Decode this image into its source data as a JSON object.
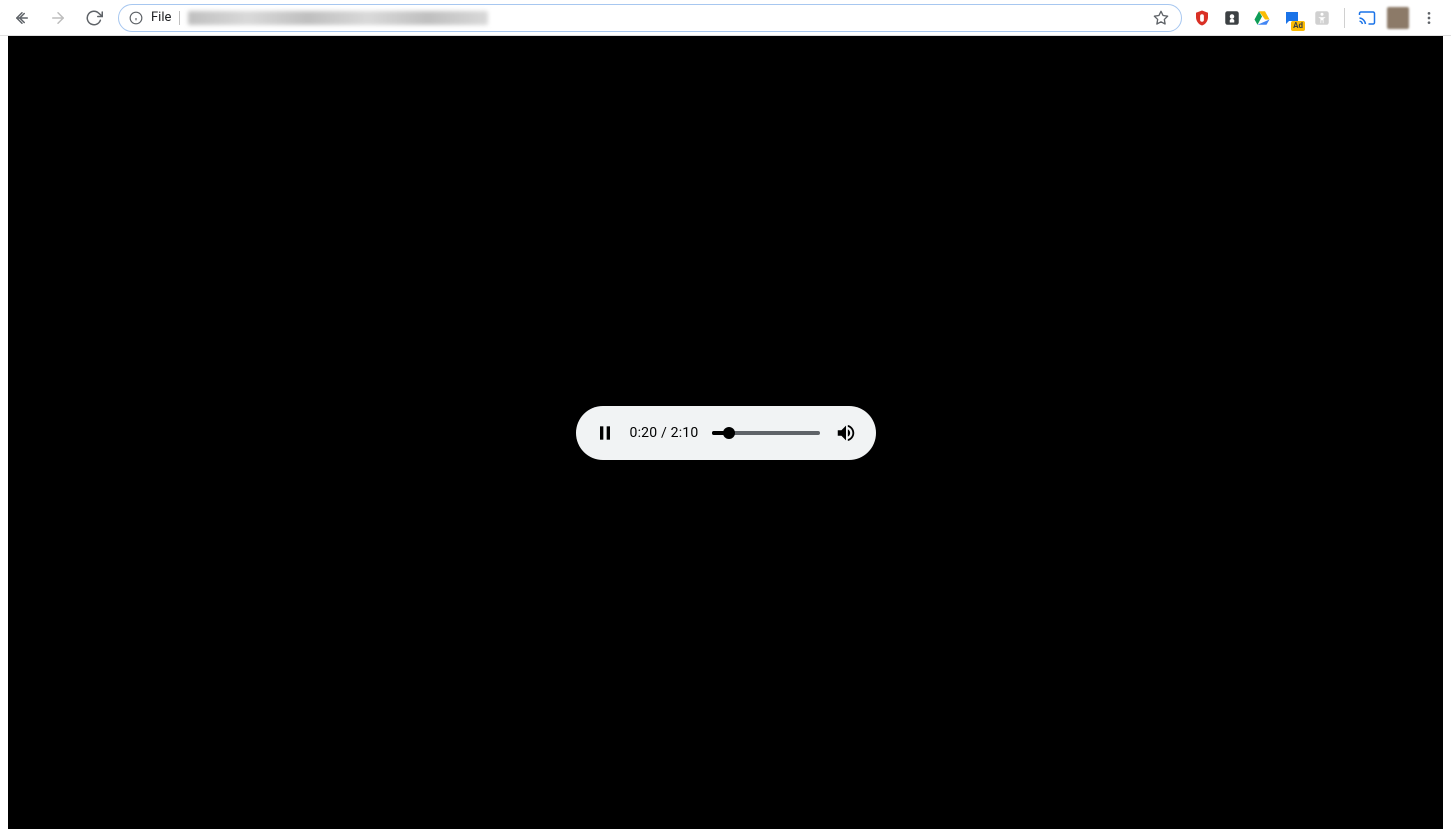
{
  "browser": {
    "scheme_label": "File",
    "nav": {
      "back_enabled": true,
      "forward_enabled": false,
      "reload_enabled": true
    },
    "star_bookmarked": false,
    "extensions": [
      {
        "name": "ublock-icon",
        "color": "#d93025",
        "shape": "shield"
      },
      {
        "name": "location-icon",
        "color": "#3c4043",
        "shape": "pin"
      },
      {
        "name": "drive-icon",
        "color": "multicolor",
        "shape": "drive"
      },
      {
        "name": "chat-icon",
        "color": "#1a73e8",
        "shape": "chat",
        "badge": "Ad",
        "badge_color": "#fbbc04"
      },
      {
        "name": "accessibility-icon",
        "color": "#bdbdbd",
        "shape": "person"
      }
    ],
    "cast_available": true
  },
  "player": {
    "state": "playing",
    "current_time": "0:20",
    "duration": "2:10",
    "separator": " / ",
    "progress_percent": 15.4,
    "muted": false
  }
}
